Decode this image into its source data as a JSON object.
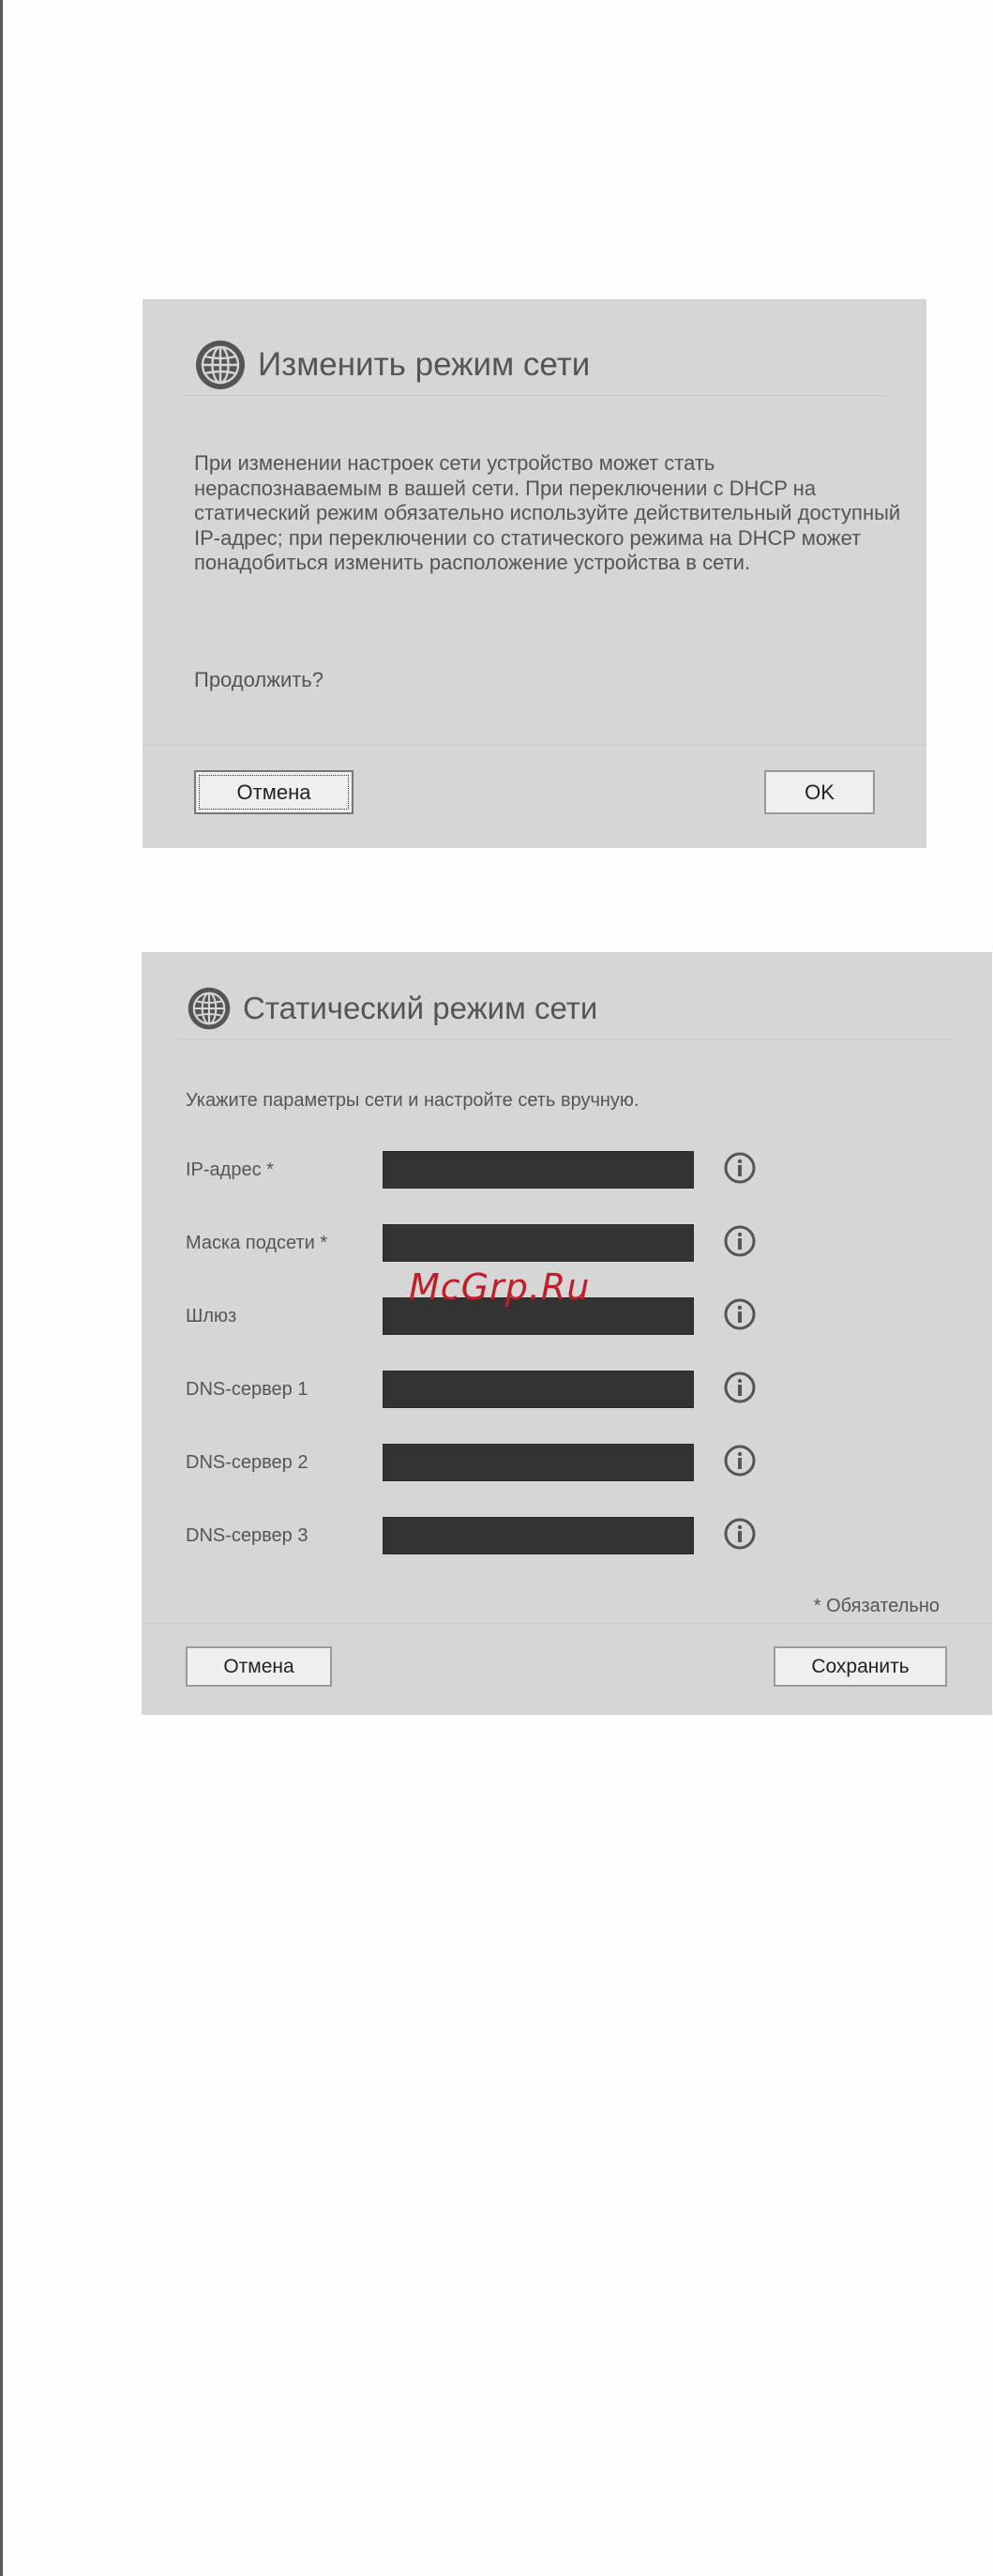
{
  "colors": {
    "panel": "#d6d6d6",
    "field": "#333333",
    "text": "#555555",
    "watermark": "#c41d2a"
  },
  "change_mode_dialog": {
    "icon": "globe-icon",
    "title": "Изменить режим сети",
    "message": "При изменении настроек сети устройство может стать нераспознаваемым в вашей сети. При переключении с DHCP на статический режим обязательно используйте действительный доступный IP-адрес; при переключении со статического режима на DHCP может понадобиться изменить расположение устройства в сети.",
    "question": "Продолжить?",
    "cancel_label": "Отмена",
    "ok_label": "OK"
  },
  "static_mode_dialog": {
    "icon": "globe-icon",
    "title": "Статический режим сети",
    "intro": "Укажите параметры сети и настройте сеть вручную.",
    "fields": [
      {
        "label": "IP-адрес *",
        "value": ""
      },
      {
        "label": "Маска подсети *",
        "value": ""
      },
      {
        "label": "Шлюз",
        "value": ""
      },
      {
        "label": "DNS-сервер 1",
        "value": ""
      },
      {
        "label": "DNS-сервер 2",
        "value": ""
      },
      {
        "label": "DNS-сервер 3",
        "value": ""
      }
    ],
    "required_note": "* Обязательно",
    "cancel_label": "Отмена",
    "save_label": "Сохранить"
  },
  "watermark": "McGrp.Ru"
}
